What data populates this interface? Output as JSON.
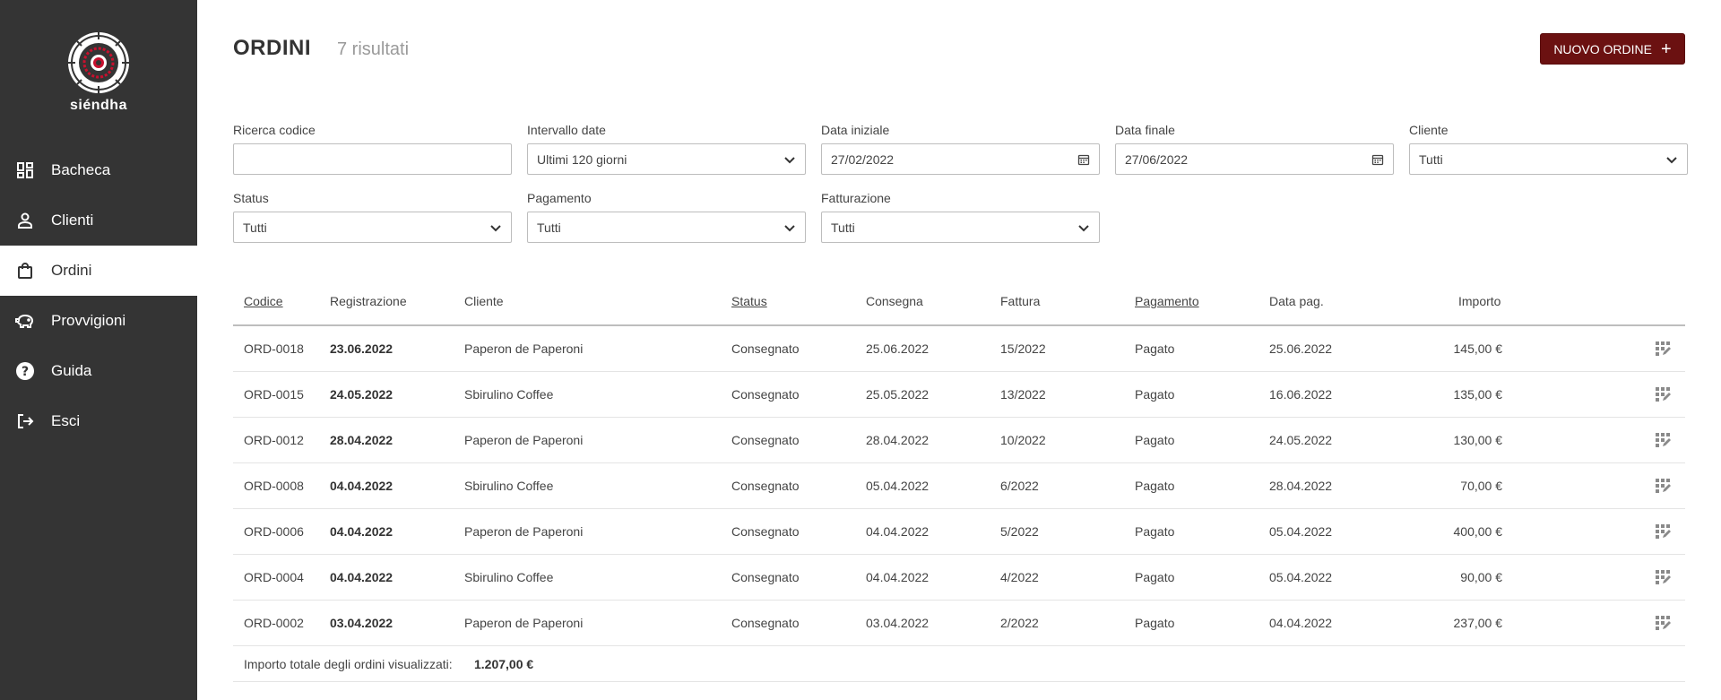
{
  "brand": {
    "name": "siéndha",
    "accent": "#6b1111",
    "sidebar_bg": "#343434"
  },
  "sidebar": {
    "items": [
      {
        "label": "Bacheca",
        "icon": "dashboard-icon",
        "active": false
      },
      {
        "label": "Clienti",
        "icon": "person-icon",
        "active": false
      },
      {
        "label": "Ordini",
        "icon": "shopping-bag-icon",
        "active": true
      },
      {
        "label": "Provvigioni",
        "icon": "piggy-bank-icon",
        "active": false
      },
      {
        "label": "Guida",
        "icon": "help-icon",
        "active": false
      },
      {
        "label": "Esci",
        "icon": "logout-icon",
        "active": false
      }
    ]
  },
  "header": {
    "title": "ORDINI",
    "result_count": "7 risultati",
    "new_order_label": "NUOVO ORDINE",
    "new_order_icon": "plus-icon"
  },
  "filters": {
    "code_search": {
      "label": "Ricerca codice",
      "value": ""
    },
    "date_range": {
      "label": "Intervallo date",
      "value": "Ultimi 120 giorni"
    },
    "start_date": {
      "label": "Data iniziale",
      "value": "27/02/2022"
    },
    "end_date": {
      "label": "Data finale",
      "value": "27/06/2022"
    },
    "client": {
      "label": "Cliente",
      "value": "Tutti"
    },
    "status": {
      "label": "Status",
      "value": "Tutti"
    },
    "payment": {
      "label": "Pagamento",
      "value": "Tutti"
    },
    "invoicing": {
      "label": "Fatturazione",
      "value": "Tutti"
    }
  },
  "table": {
    "columns": {
      "code": "Codice",
      "registration": "Registrazione",
      "client": "Cliente",
      "status": "Status",
      "delivery": "Consegna",
      "invoice": "Fattura",
      "payment": "Pagamento",
      "payment_date": "Data pag.",
      "amount": "Importo"
    },
    "rows": [
      {
        "code": "ORD-0018",
        "registration": "23.06.2022",
        "client": "Paperon de Paperoni",
        "status": "Consegnato",
        "delivery": "25.06.2022",
        "invoice": "15/2022",
        "payment": "Pagato",
        "payment_date": "25.06.2022",
        "amount": "145,00 €"
      },
      {
        "code": "ORD-0015",
        "registration": "24.05.2022",
        "client": "Sbirulino Coffee",
        "status": "Consegnato",
        "delivery": "25.05.2022",
        "invoice": "13/2022",
        "payment": "Pagato",
        "payment_date": "16.06.2022",
        "amount": "135,00 €"
      },
      {
        "code": "ORD-0012",
        "registration": "28.04.2022",
        "client": "Paperon de Paperoni",
        "status": "Consegnato",
        "delivery": "28.04.2022",
        "invoice": "10/2022",
        "payment": "Pagato",
        "payment_date": "24.05.2022",
        "amount": "130,00 €"
      },
      {
        "code": "ORD-0008",
        "registration": "04.04.2022",
        "client": "Sbirulino Coffee",
        "status": "Consegnato",
        "delivery": "05.04.2022",
        "invoice": "6/2022",
        "payment": "Pagato",
        "payment_date": "28.04.2022",
        "amount": "70,00 €"
      },
      {
        "code": "ORD-0006",
        "registration": "04.04.2022",
        "client": "Paperon de Paperoni",
        "status": "Consegnato",
        "delivery": "04.04.2022",
        "invoice": "5/2022",
        "payment": "Pagato",
        "payment_date": "05.04.2022",
        "amount": "400,00 €"
      },
      {
        "code": "ORD-0004",
        "registration": "04.04.2022",
        "client": "Sbirulino Coffee",
        "status": "Consegnato",
        "delivery": "04.04.2022",
        "invoice": "4/2022",
        "payment": "Pagato",
        "payment_date": "05.04.2022",
        "amount": "90,00 €"
      },
      {
        "code": "ORD-0002",
        "registration": "03.04.2022",
        "client": "Paperon de Paperoni",
        "status": "Consegnato",
        "delivery": "03.04.2022",
        "invoice": "2/2022",
        "payment": "Pagato",
        "payment_date": "04.04.2022",
        "amount": "237,00 €"
      }
    ],
    "row_action_icon": "edit-grid-icon",
    "footer": {
      "label": "Importo totale degli ordini visualizzati:",
      "total": "1.207,00 €"
    }
  }
}
